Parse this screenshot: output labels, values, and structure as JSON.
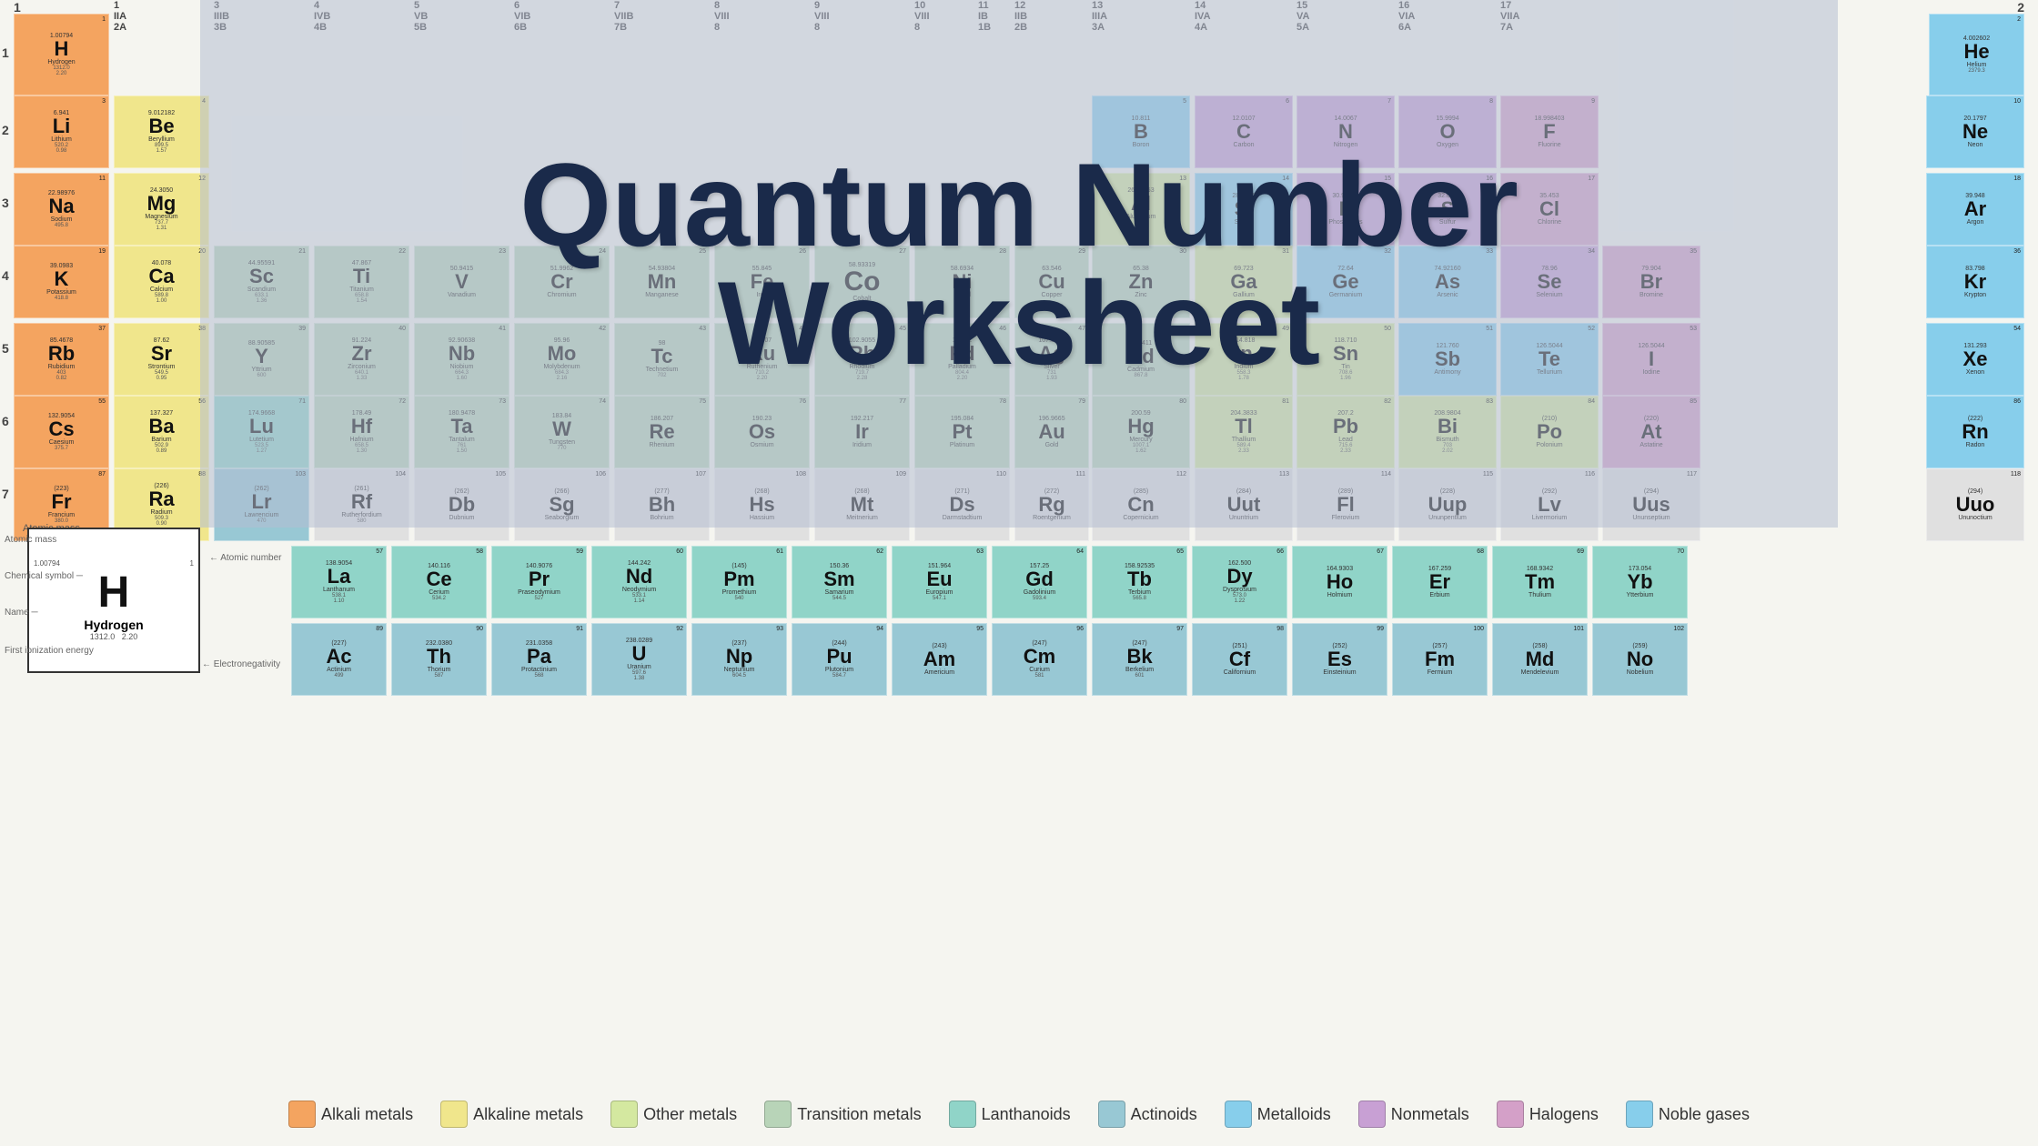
{
  "title": {
    "line1": "Quantum Number",
    "line2": "Worksheet"
  },
  "legend": {
    "items": [
      {
        "label": "Alkali metals",
        "color": "#f4a460"
      },
      {
        "label": "Alkaline metals",
        "color": "#f0e68c"
      },
      {
        "label": "Other metals",
        "color": "#d4e8a0"
      },
      {
        "label": "Transition metals",
        "color": "#b8d4b8"
      },
      {
        "label": "Lanthanoids",
        "color": "#90d4c8"
      },
      {
        "label": "Actinoids",
        "color": "#98c8d4"
      },
      {
        "label": "Metalloids",
        "color": "#87ceeb"
      },
      {
        "label": "Nonmetals",
        "color": "#c8a0d4"
      },
      {
        "label": "Halogens",
        "color": "#d4a0c8"
      },
      {
        "label": "Noble gases",
        "color": "#87ceeb"
      }
    ]
  },
  "element_key": {
    "atomic_mass_label": "Atomic mass",
    "atomic_num_label": "Atomic number",
    "chemical_symbol_label": "Chemical symbol",
    "name_label": "Name",
    "ionization_label": "First ionization energy",
    "electronegativity_label": "Electronegativity",
    "symbol": "H",
    "name": "Hydrogen",
    "atomic_mass": "1.00794",
    "atomic_num": "1",
    "ionization": "1312.0",
    "electronegativity": "2.20"
  },
  "groups": [
    "1",
    "IIA\n2A",
    "3",
    "4",
    "5",
    "6",
    "7",
    "8",
    "9",
    "10",
    "11",
    "12",
    "13\nIIIA\n3A",
    "14\nIVA\n4A",
    "15\nVA\n5A",
    "16\nVIA\n6A",
    "17\nVIIA\n7A",
    "2"
  ],
  "periods": [
    "1",
    "2",
    "3",
    "4",
    "5",
    "6",
    "7"
  ]
}
